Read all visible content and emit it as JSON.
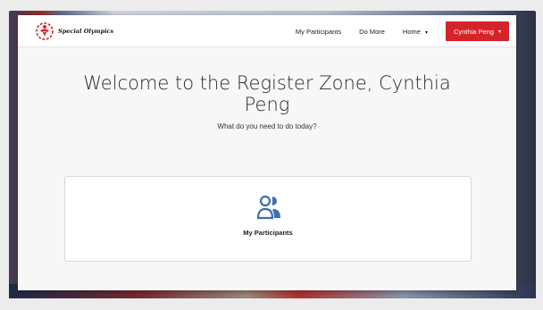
{
  "brand": {
    "name": "Special Olympics",
    "accent_color": "#d6232a"
  },
  "nav": {
    "links": [
      {
        "label": "My Participants"
      },
      {
        "label": "Do More"
      },
      {
        "label": "Home",
        "caret": "▾"
      }
    ],
    "user": {
      "label": "Cynthia Peng",
      "caret": "▾"
    }
  },
  "main": {
    "welcome": "Welcome to the Register Zone, Cynthia Peng",
    "subtitle": "What do you need to do today?",
    "cards": [
      {
        "label": "My Participants",
        "icon": "users-icon",
        "icon_color": "#3b6fb0"
      }
    ]
  }
}
